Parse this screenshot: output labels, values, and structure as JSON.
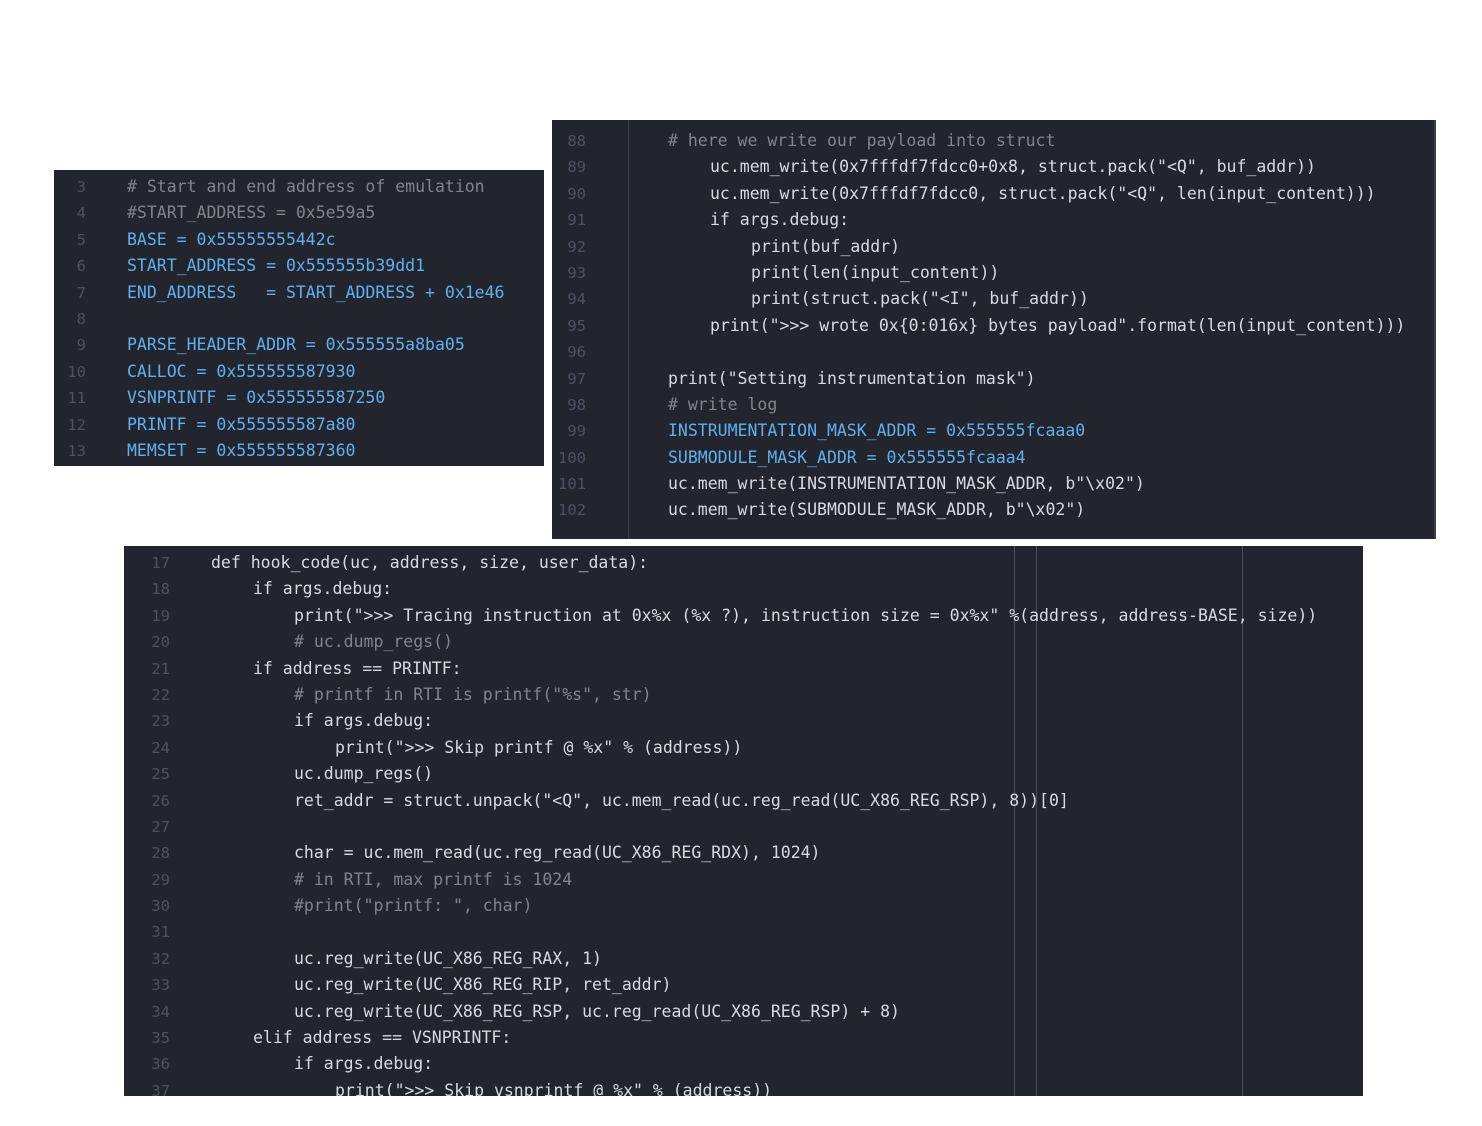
{
  "panels": {
    "a": {
      "lines": [
        {
          "n": "3",
          "t": "# Start and end address of emulation"
        },
        {
          "n": "4",
          "t": "#START_ADDRESS = 0x5e59a5"
        },
        {
          "n": "5",
          "t": "BASE = 0x55555555442c"
        },
        {
          "n": "6",
          "t": "START_ADDRESS = 0x555555b39dd1"
        },
        {
          "n": "7",
          "t": "END_ADDRESS   = START_ADDRESS + 0x1e46"
        },
        {
          "n": "8",
          "t": ""
        },
        {
          "n": "9",
          "t": "PARSE_HEADER_ADDR = 0x555555a8ba05"
        },
        {
          "n": "10",
          "t": "CALLOC = 0x555555587930"
        },
        {
          "n": "11",
          "t": "VSNPRINTF = 0x555555587250"
        },
        {
          "n": "12",
          "t": "PRINTF = 0x555555587a80"
        },
        {
          "n": "13",
          "t": "MEMSET = 0x555555587360"
        }
      ]
    },
    "b": {
      "lines": [
        {
          "n": "88",
          "t": "# here we write our payload into struct"
        },
        {
          "n": "89",
          "t": "uc.mem_write(0x7fffdf7fdcc0+0x8, struct.pack(\"<Q\", buf_addr))"
        },
        {
          "n": "90",
          "t": "uc.mem_write(0x7fffdf7fdcc0, struct.pack(\"<Q\", len(input_content)))"
        },
        {
          "n": "91",
          "t": "if args.debug:"
        },
        {
          "n": "92",
          "t": "print(buf_addr)"
        },
        {
          "n": "93",
          "t": "print(len(input_content))"
        },
        {
          "n": "94",
          "t": "print(struct.pack(\"<I\", buf_addr))"
        },
        {
          "n": "95",
          "t": "print(\">>> wrote 0x{0:016x} bytes payload\".format(len(input_content)))"
        },
        {
          "n": "96",
          "t": ""
        },
        {
          "n": "97",
          "t": "print(\"Setting instrumentation mask\")"
        },
        {
          "n": "98",
          "t": "# write log"
        },
        {
          "n": "99",
          "t": "INSTRUMENTATION_MASK_ADDR = 0x555555fcaaa0"
        },
        {
          "n": "100",
          "t": "SUBMODULE_MASK_ADDR = 0x555555fcaaa4"
        },
        {
          "n": "101",
          "t": "uc.mem_write(INSTRUMENTATION_MASK_ADDR, b\"\\x02\")"
        },
        {
          "n": "102",
          "t": "uc.mem_write(SUBMODULE_MASK_ADDR, b\"\\x02\")"
        }
      ]
    },
    "c": {
      "lines": [
        {
          "n": "17",
          "t": "def hook_code(uc, address, size, user_data):"
        },
        {
          "n": "18",
          "t": "if args.debug:"
        },
        {
          "n": "19",
          "t": "print(\">>> Tracing instruction at 0x%x (%x ?), instruction size = 0x%x\" %(address, address-BASE, size))"
        },
        {
          "n": "20",
          "t": "# uc.dump_regs()"
        },
        {
          "n": "21",
          "t": "if address == PRINTF:"
        },
        {
          "n": "22",
          "t": "# printf in RTI is printf(\"%s\", str)"
        },
        {
          "n": "23",
          "t": "if args.debug:"
        },
        {
          "n": "24",
          "t": "print(\">>> Skip printf @ %x\" % (address))"
        },
        {
          "n": "25",
          "t": "uc.dump_regs()"
        },
        {
          "n": "26",
          "t": "ret_addr = struct.unpack(\"<Q\", uc.mem_read(uc.reg_read(UC_X86_REG_RSP), 8))[0]"
        },
        {
          "n": "27",
          "t": ""
        },
        {
          "n": "28",
          "t": "char = uc.mem_read(uc.reg_read(UC_X86_REG_RDX), 1024)"
        },
        {
          "n": "29",
          "t": "# in RTI, max printf is 1024"
        },
        {
          "n": "30",
          "t": "#print(\"printf: \", char)"
        },
        {
          "n": "31",
          "t": ""
        },
        {
          "n": "32",
          "t": "uc.reg_write(UC_X86_REG_RAX, 1)"
        },
        {
          "n": "33",
          "t": "uc.reg_write(UC_X86_REG_RIP, ret_addr)"
        },
        {
          "n": "34",
          "t": "uc.reg_write(UC_X86_REG_RSP, uc.reg_read(UC_X86_REG_RSP) + 8)"
        },
        {
          "n": "35",
          "t": "elif address == VSNPRINTF:"
        },
        {
          "n": "36",
          "t": "if args.debug:"
        },
        {
          "n": "37",
          "t": "print(\">>> Skip vsnprintf @ %x\" % (address))"
        }
      ]
    }
  }
}
